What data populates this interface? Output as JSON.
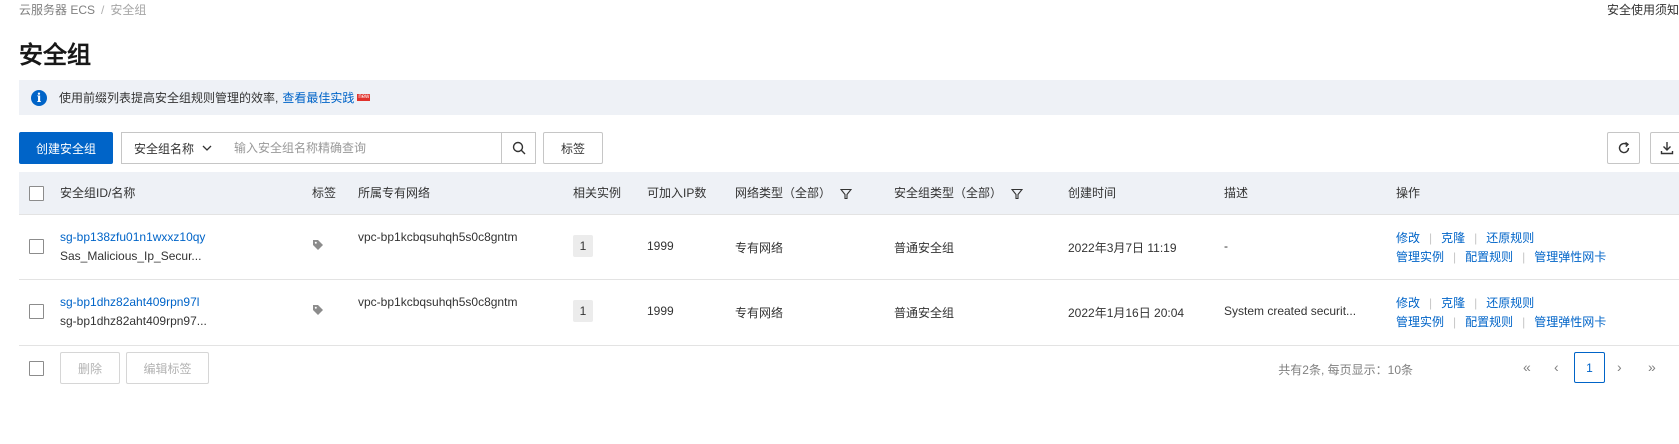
{
  "breadcrumb": {
    "root": "云服务器 ECS",
    "separator": "/",
    "current": "安全组"
  },
  "header": {
    "notice_link": "安全使用须知"
  },
  "page": {
    "title": "安全组"
  },
  "info_bar": {
    "text": "使用前缀列表提高安全组规则管理的效率,",
    "link": "查看最佳实践",
    "badge": "new"
  },
  "toolbar": {
    "create_label": "创建安全组",
    "filter_select": "安全组名称",
    "search_placeholder": "输入安全组名称精确查询",
    "tag_label": "标签"
  },
  "table": {
    "headers": {
      "id_name": "安全组ID/名称",
      "tag": "标签",
      "vpc": "所属专有网络",
      "instances": "相关实例",
      "ip_count": "可加入IP数",
      "network_type": "网络类型（全部）",
      "sg_type": "安全组类型（全部）",
      "created": "创建时间",
      "desc": "描述",
      "ops": "操作"
    },
    "rows": [
      {
        "id": "sg-bp138zfu01n1wxxz10qy",
        "name": "Sas_Malicious_Ip_Secur...",
        "vpc": "vpc-bp1kcbqsuhqh5s0c8gntm",
        "instances": "1",
        "ip_count": "1999",
        "network_type": "专有网络",
        "sg_type": "普通安全组",
        "created": "2022年3月7日 11:19",
        "desc": "-",
        "ops": {
          "modify": "修改",
          "clone": "克隆",
          "restore": "还原规则",
          "manage_instances": "管理实例",
          "config_rules": "配置规则",
          "manage_eni": "管理弹性网卡"
        }
      },
      {
        "id": "sg-bp1dhz82aht409rpn97l",
        "name": "sg-bp1dhz82aht409rpn97...",
        "vpc": "vpc-bp1kcbqsuhqh5s0c8gntm",
        "instances": "1",
        "ip_count": "1999",
        "network_type": "专有网络",
        "sg_type": "普通安全组",
        "created": "2022年1月16日 20:04",
        "desc": "System created securit...",
        "ops": {
          "modify": "修改",
          "clone": "克隆",
          "restore": "还原规则",
          "manage_instances": "管理实例",
          "config_rules": "配置规则",
          "manage_eni": "管理弹性网卡"
        }
      }
    ]
  },
  "footer": {
    "delete_label": "删除",
    "edit_tags_label": "编辑标签",
    "pagination_info": "共有2条, 每页显示：10条",
    "current_page": "1",
    "arrows": {
      "first": "«",
      "prev": "‹",
      "next": "›",
      "last": "»"
    }
  },
  "icons": {
    "info": "info-icon",
    "search": "search-icon",
    "refresh": "refresh-icon",
    "download": "download-icon",
    "filter": "filter-icon",
    "tag": "tag-icon",
    "chevron": "chevron-down-icon"
  },
  "colors": {
    "accent": "#0064c8",
    "header_bg": "#eef1f6",
    "new_badge": "#e0322c"
  }
}
